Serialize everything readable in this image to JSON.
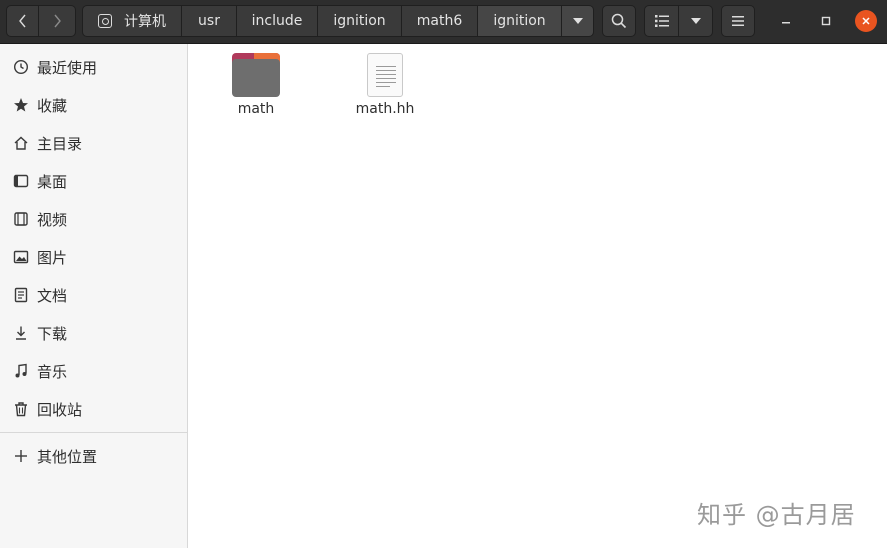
{
  "window": {
    "title": "ignition"
  },
  "pathbar": {
    "crumbs": [
      {
        "label": "计算机",
        "icon": "drive-icon"
      },
      {
        "label": "usr"
      },
      {
        "label": "include"
      },
      {
        "label": "ignition"
      },
      {
        "label": "math6"
      },
      {
        "label": "ignition",
        "active": true
      }
    ]
  },
  "sidebar": {
    "items": [
      {
        "label": "最近使用",
        "icon": "clock-icon"
      },
      {
        "label": "收藏",
        "icon": "star-icon"
      },
      {
        "label": "主目录",
        "icon": "home-icon"
      },
      {
        "label": "桌面",
        "icon": "desktop-icon"
      },
      {
        "label": "视频",
        "icon": "video-icon"
      },
      {
        "label": "图片",
        "icon": "image-icon"
      },
      {
        "label": "文档",
        "icon": "document-icon"
      },
      {
        "label": "下载",
        "icon": "download-icon"
      },
      {
        "label": "音乐",
        "icon": "music-icon"
      },
      {
        "label": "回收站",
        "icon": "trash-icon"
      }
    ],
    "other": {
      "label": "其他位置",
      "icon": "plus-icon"
    }
  },
  "files": [
    {
      "name": "math",
      "type": "folder",
      "icon": "folder-icon"
    },
    {
      "name": "math.hh",
      "type": "file",
      "icon": "text-file-icon"
    }
  ],
  "watermark": {
    "text": "知乎 @古月居"
  },
  "colors": {
    "headerbar": "#2d2d2d",
    "accent_close": "#e95420",
    "folder_tab": "#b03a5b",
    "folder_tab_right": "#e9703a",
    "folder_body": "#6e6e6e"
  }
}
